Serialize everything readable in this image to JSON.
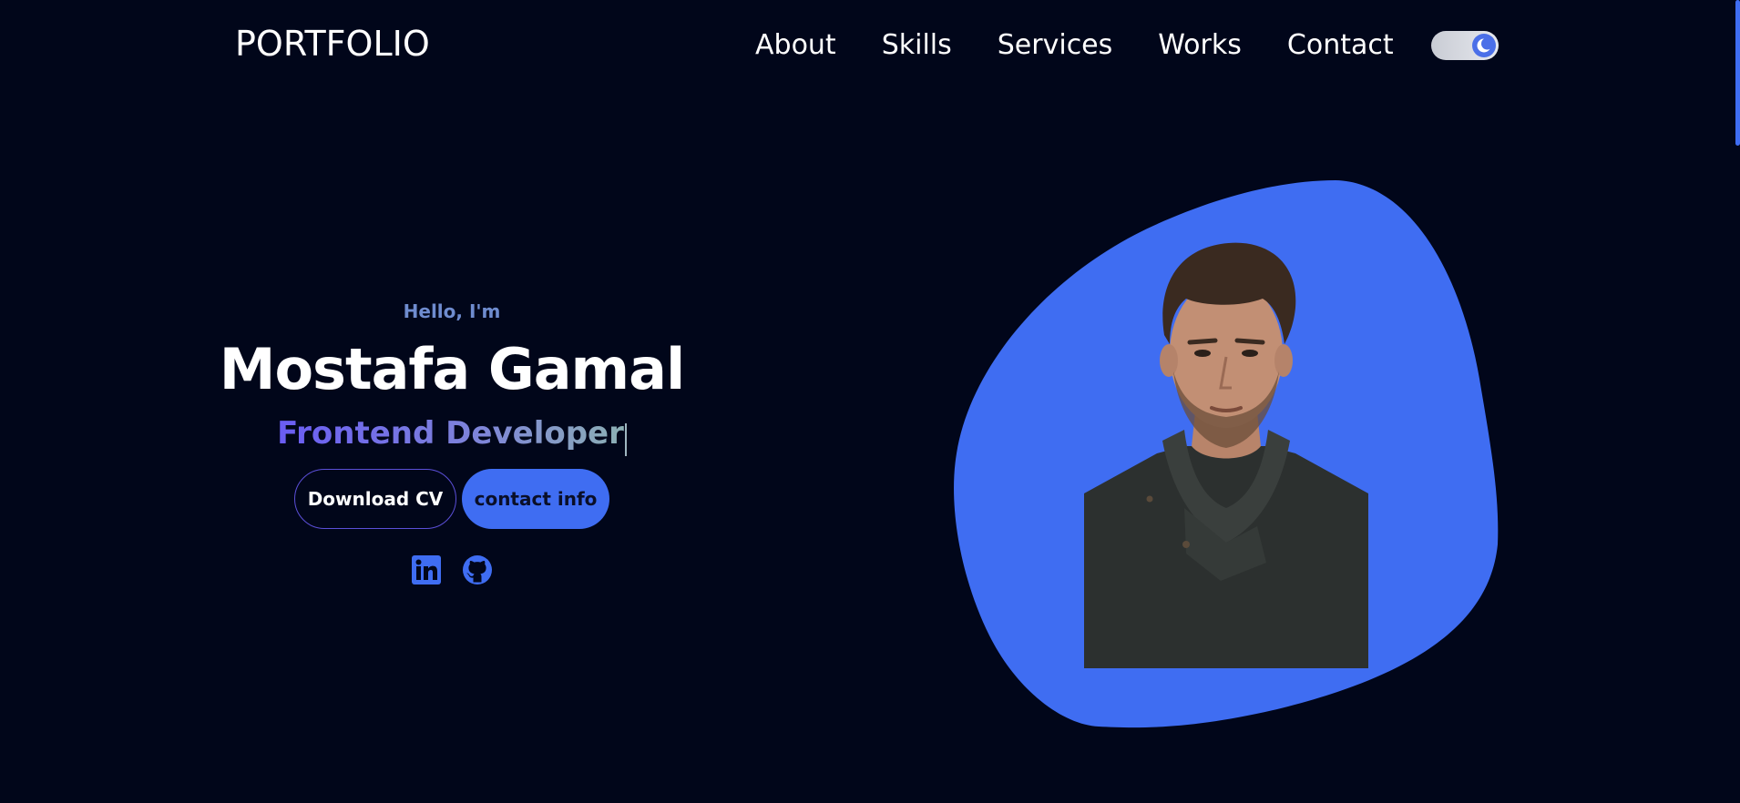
{
  "nav": {
    "logo": "PORTFOLIO",
    "links": [
      "About",
      "Skills",
      "Services",
      "Works",
      "Contact"
    ],
    "theme_toggle": {
      "mode": "dark",
      "icon": "moon-icon"
    }
  },
  "hero": {
    "greeting": "Hello, I'm",
    "name": "Mostafa Gamal",
    "role": "Frontend Developer",
    "buttons": {
      "download": "Download CV",
      "contact": "contact info"
    },
    "socials": [
      {
        "icon": "linkedin-icon"
      },
      {
        "icon": "github-icon"
      }
    ]
  },
  "colors": {
    "background": "#01061a",
    "accent": "#3f6df2",
    "greeting": "#6f8ccf",
    "outline_border": "#5b4fd8"
  }
}
